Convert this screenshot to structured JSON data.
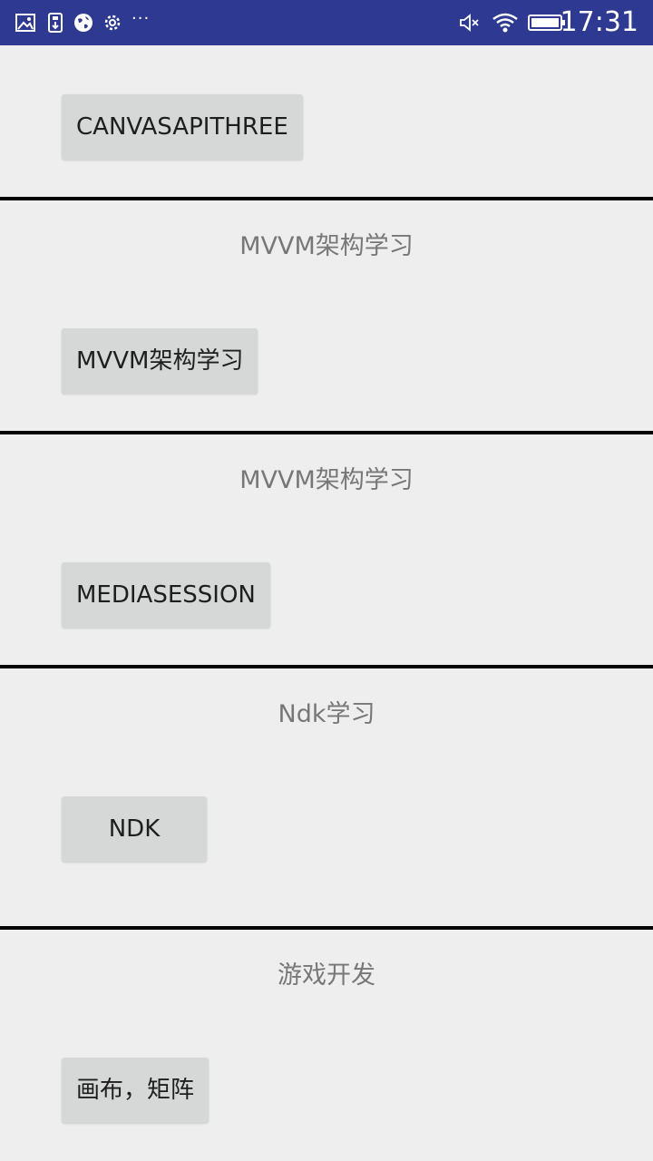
{
  "status_bar": {
    "time": "17:31",
    "left_icons": [
      "image-icon",
      "usb-icon",
      "globe-icon",
      "settings-icon",
      "more-icon"
    ],
    "overflow": "···",
    "right_icons": [
      "mute-icon",
      "wifi-icon",
      "battery-icon"
    ]
  },
  "sections": [
    {
      "title": "",
      "button": "CANVASAPITHREE"
    },
    {
      "title": "MVVM架构学习",
      "button": "MVVM架构学习"
    },
    {
      "title": "MVVM架构学习",
      "button": "MEDIASESSION"
    },
    {
      "title": "Ndk学习",
      "button": "NDK"
    },
    {
      "title": "游戏开发",
      "button": "画布，矩阵"
    }
  ]
}
